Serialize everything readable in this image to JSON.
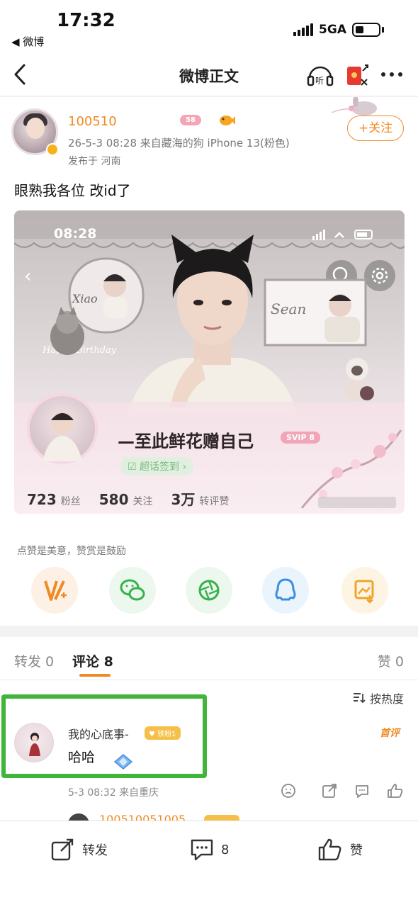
{
  "status_bar": {
    "time": "17:32",
    "back_app": "◀ 微博",
    "network": "5GA"
  },
  "nav": {
    "title": "微博正文"
  },
  "post": {
    "username": "100510",
    "level_badge": "58",
    "meta": "26-5-3 08:28  来自藏海的狗 iPhone 13(粉色)",
    "location": "发布于 河南",
    "follow_label": "+关注",
    "text": "眼熟我各位 改id了"
  },
  "screenshot": {
    "time": "08:28",
    "name": "—至此鲜花赠自己",
    "svip": "SVIP 8",
    "checkin": "☑ 超话签到 ›",
    "stats": [
      {
        "num": "723",
        "label": "粉丝"
      },
      {
        "num": "580",
        "label": "关注"
      },
      {
        "num": "3万",
        "label": "转评赞"
      }
    ],
    "frame_left_text": "Xiao",
    "frame_right_text": "Sean",
    "birthday_text": "Happy Birthday"
  },
  "reward": {
    "hint": "点赞是美意，赞赏是鼓励"
  },
  "share_icons": [
    "v-plus-icon",
    "wechat-icon",
    "moments-icon",
    "qq-icon",
    "save-image-icon"
  ],
  "tabs": {
    "repost": "转发 0",
    "comment": "评论 8",
    "like": "赞 0",
    "sort": "按热度"
  },
  "comment": {
    "username": "我的心底事-",
    "badge": "♥ 铁粉1",
    "text": "哈哈",
    "first_label": "首评",
    "meta": "5-3 08:32  来自重庆"
  },
  "reply": {
    "username": "100510051005"
  },
  "bottom_bar": {
    "repost": "转发",
    "comments": "8",
    "like": "赞"
  },
  "colors": {
    "accent": "#f08a24",
    "highlight": "#3fb53b"
  }
}
